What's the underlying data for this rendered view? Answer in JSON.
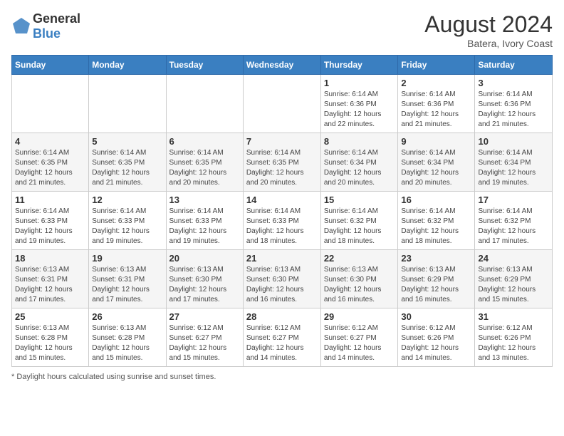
{
  "header": {
    "logo_general": "General",
    "logo_blue": "Blue",
    "title": "August 2024",
    "subtitle": "Batera, Ivory Coast"
  },
  "days_of_week": [
    "Sunday",
    "Monday",
    "Tuesday",
    "Wednesday",
    "Thursday",
    "Friday",
    "Saturday"
  ],
  "footer": {
    "note": "Daylight hours"
  },
  "weeks": [
    {
      "days": [
        {
          "num": "",
          "info": ""
        },
        {
          "num": "",
          "info": ""
        },
        {
          "num": "",
          "info": ""
        },
        {
          "num": "",
          "info": ""
        },
        {
          "num": "1",
          "info": "Sunrise: 6:14 AM\nSunset: 6:36 PM\nDaylight: 12 hours\nand 22 minutes."
        },
        {
          "num": "2",
          "info": "Sunrise: 6:14 AM\nSunset: 6:36 PM\nDaylight: 12 hours\nand 21 minutes."
        },
        {
          "num": "3",
          "info": "Sunrise: 6:14 AM\nSunset: 6:36 PM\nDaylight: 12 hours\nand 21 minutes."
        }
      ]
    },
    {
      "days": [
        {
          "num": "4",
          "info": "Sunrise: 6:14 AM\nSunset: 6:35 PM\nDaylight: 12 hours\nand 21 minutes."
        },
        {
          "num": "5",
          "info": "Sunrise: 6:14 AM\nSunset: 6:35 PM\nDaylight: 12 hours\nand 21 minutes."
        },
        {
          "num": "6",
          "info": "Sunrise: 6:14 AM\nSunset: 6:35 PM\nDaylight: 12 hours\nand 20 minutes."
        },
        {
          "num": "7",
          "info": "Sunrise: 6:14 AM\nSunset: 6:35 PM\nDaylight: 12 hours\nand 20 minutes."
        },
        {
          "num": "8",
          "info": "Sunrise: 6:14 AM\nSunset: 6:34 PM\nDaylight: 12 hours\nand 20 minutes."
        },
        {
          "num": "9",
          "info": "Sunrise: 6:14 AM\nSunset: 6:34 PM\nDaylight: 12 hours\nand 20 minutes."
        },
        {
          "num": "10",
          "info": "Sunrise: 6:14 AM\nSunset: 6:34 PM\nDaylight: 12 hours\nand 19 minutes."
        }
      ]
    },
    {
      "days": [
        {
          "num": "11",
          "info": "Sunrise: 6:14 AM\nSunset: 6:33 PM\nDaylight: 12 hours\nand 19 minutes."
        },
        {
          "num": "12",
          "info": "Sunrise: 6:14 AM\nSunset: 6:33 PM\nDaylight: 12 hours\nand 19 minutes."
        },
        {
          "num": "13",
          "info": "Sunrise: 6:14 AM\nSunset: 6:33 PM\nDaylight: 12 hours\nand 19 minutes."
        },
        {
          "num": "14",
          "info": "Sunrise: 6:14 AM\nSunset: 6:33 PM\nDaylight: 12 hours\nand 18 minutes."
        },
        {
          "num": "15",
          "info": "Sunrise: 6:14 AM\nSunset: 6:32 PM\nDaylight: 12 hours\nand 18 minutes."
        },
        {
          "num": "16",
          "info": "Sunrise: 6:14 AM\nSunset: 6:32 PM\nDaylight: 12 hours\nand 18 minutes."
        },
        {
          "num": "17",
          "info": "Sunrise: 6:14 AM\nSunset: 6:32 PM\nDaylight: 12 hours\nand 17 minutes."
        }
      ]
    },
    {
      "days": [
        {
          "num": "18",
          "info": "Sunrise: 6:13 AM\nSunset: 6:31 PM\nDaylight: 12 hours\nand 17 minutes."
        },
        {
          "num": "19",
          "info": "Sunrise: 6:13 AM\nSunset: 6:31 PM\nDaylight: 12 hours\nand 17 minutes."
        },
        {
          "num": "20",
          "info": "Sunrise: 6:13 AM\nSunset: 6:30 PM\nDaylight: 12 hours\nand 17 minutes."
        },
        {
          "num": "21",
          "info": "Sunrise: 6:13 AM\nSunset: 6:30 PM\nDaylight: 12 hours\nand 16 minutes."
        },
        {
          "num": "22",
          "info": "Sunrise: 6:13 AM\nSunset: 6:30 PM\nDaylight: 12 hours\nand 16 minutes."
        },
        {
          "num": "23",
          "info": "Sunrise: 6:13 AM\nSunset: 6:29 PM\nDaylight: 12 hours\nand 16 minutes."
        },
        {
          "num": "24",
          "info": "Sunrise: 6:13 AM\nSunset: 6:29 PM\nDaylight: 12 hours\nand 15 minutes."
        }
      ]
    },
    {
      "days": [
        {
          "num": "25",
          "info": "Sunrise: 6:13 AM\nSunset: 6:28 PM\nDaylight: 12 hours\nand 15 minutes."
        },
        {
          "num": "26",
          "info": "Sunrise: 6:13 AM\nSunset: 6:28 PM\nDaylight: 12 hours\nand 15 minutes."
        },
        {
          "num": "27",
          "info": "Sunrise: 6:12 AM\nSunset: 6:27 PM\nDaylight: 12 hours\nand 15 minutes."
        },
        {
          "num": "28",
          "info": "Sunrise: 6:12 AM\nSunset: 6:27 PM\nDaylight: 12 hours\nand 14 minutes."
        },
        {
          "num": "29",
          "info": "Sunrise: 6:12 AM\nSunset: 6:27 PM\nDaylight: 12 hours\nand 14 minutes."
        },
        {
          "num": "30",
          "info": "Sunrise: 6:12 AM\nSunset: 6:26 PM\nDaylight: 12 hours\nand 14 minutes."
        },
        {
          "num": "31",
          "info": "Sunrise: 6:12 AM\nSunset: 6:26 PM\nDaylight: 12 hours\nand 13 minutes."
        }
      ]
    }
  ]
}
